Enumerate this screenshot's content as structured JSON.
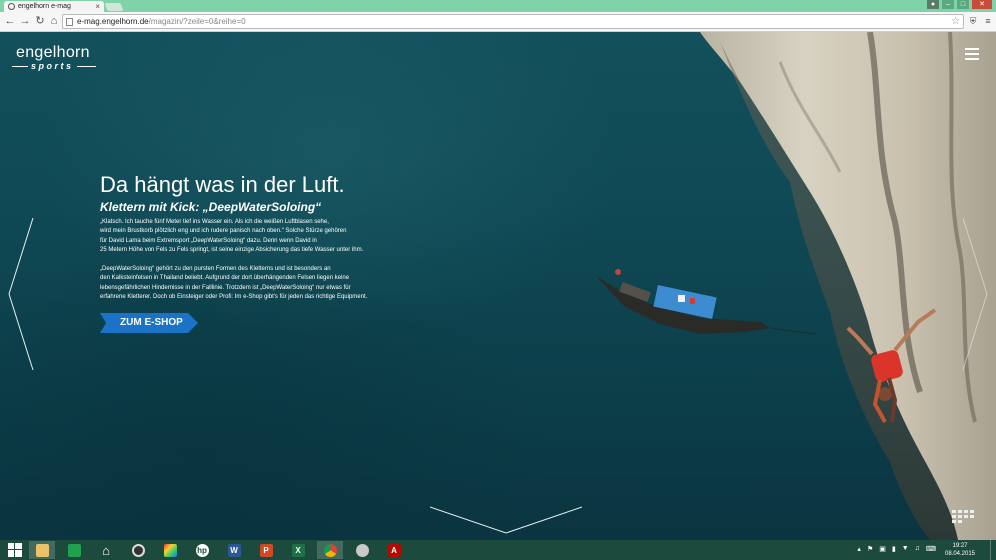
{
  "browser": {
    "tab_title": "engelhorn e-mag",
    "tab_close": "×",
    "url_domain": "e-mag.engelhorn.de",
    "url_path": "/magazin/?zeile=0&reihe=0"
  },
  "page": {
    "logo": {
      "line1": "engelhorn",
      "line2": "sports"
    },
    "headline": "Da hängt was in der Luft.",
    "subheadline": "Klettern mit Kick: „DeepWaterSoloing“",
    "body_lines_1": [
      "„Klatsch. Ich tauche fünf Meter tief ins Wasser ein. Als ich die weißen Luftblasen sehe,",
      "wird mein Brustkorb plötzlich eng und ich rudere panisch nach oben.“ Solche Stürze gehören",
      "für David Lama beim Extremsport „DeepWaterSoloing“ dazu. Denn wenn David in",
      "25 Metern Höhe von Fels zu Fels springt, ist seine einzige Absicherung das tiefe Wasser unter ihm."
    ],
    "body_lines_2": [
      "„DeepWaterSoloing“ gehört zu den pursten Formen des Kletterns und ist besonders an",
      "den Kalksteinfelsen in Thailand beliebt. Aufgrund der dort überhängenden Felsen liegen keine",
      "lebensgefährlichen Hindernisse in der Falllinie. Trotzdem ist „DeepWaterSoloing“ nur etwas für",
      "erfahrene Kletterer. Doch ob Einsteiger oder Profi: Im e-Shop gibt's für jeden das richtige Equipment."
    ],
    "cta_label": "ZUM E-SHOP",
    "cta_color": "#1a73c6"
  },
  "taskbar": {
    "items": [
      {
        "icon": "windows-start-icon"
      },
      {
        "icon": "file-explorer-icon"
      },
      {
        "icon": "store-icon"
      },
      {
        "icon": "home-icon"
      },
      {
        "icon": "camera-app-icon"
      },
      {
        "icon": "color-app-icon"
      },
      {
        "icon": "hp-icon"
      },
      {
        "icon": "word-icon"
      },
      {
        "icon": "powerpoint-icon"
      },
      {
        "icon": "excel-icon"
      },
      {
        "icon": "chrome-icon"
      },
      {
        "icon": "paint-icon"
      },
      {
        "icon": "acrobat-icon"
      }
    ],
    "time": "19:27",
    "date": "08.04.2015"
  }
}
